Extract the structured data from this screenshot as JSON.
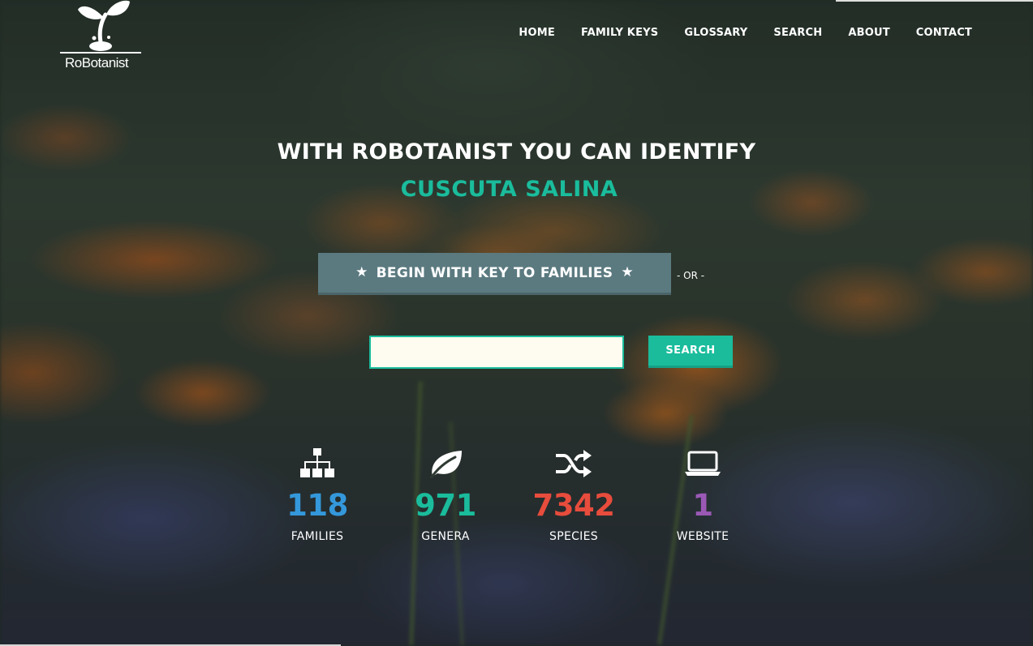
{
  "brand": {
    "name": "RoBotanist"
  },
  "nav": {
    "items": [
      "HOME",
      "FAMILY KEYS",
      "GLOSSARY",
      "SEARCH",
      "ABOUT",
      "CONTACT"
    ]
  },
  "hero": {
    "headline": "WITH ROBOTANIST YOU CAN IDENTIFY",
    "species": "CUSCUTA SALINA",
    "begin_label": "BEGIN WITH KEY TO FAMILIES",
    "or_text": "- OR -",
    "search_value": "",
    "search_button": "SEARCH"
  },
  "stats": [
    {
      "icon": "sitemap-icon",
      "value": "118",
      "label": "FAMILIES",
      "color": "#3498db"
    },
    {
      "icon": "leaf-icon",
      "value": "971",
      "label": "GENERA",
      "color": "#1abc9c"
    },
    {
      "icon": "shuffle-icon",
      "value": "7342",
      "label": "SPECIES",
      "color": "#e74c3c"
    },
    {
      "icon": "laptop-icon",
      "value": "1",
      "label": "WEBSITE",
      "color": "#9b59b6"
    }
  ],
  "colors": {
    "accent": "#1abc9c",
    "begin_button": "#5b7a80"
  }
}
